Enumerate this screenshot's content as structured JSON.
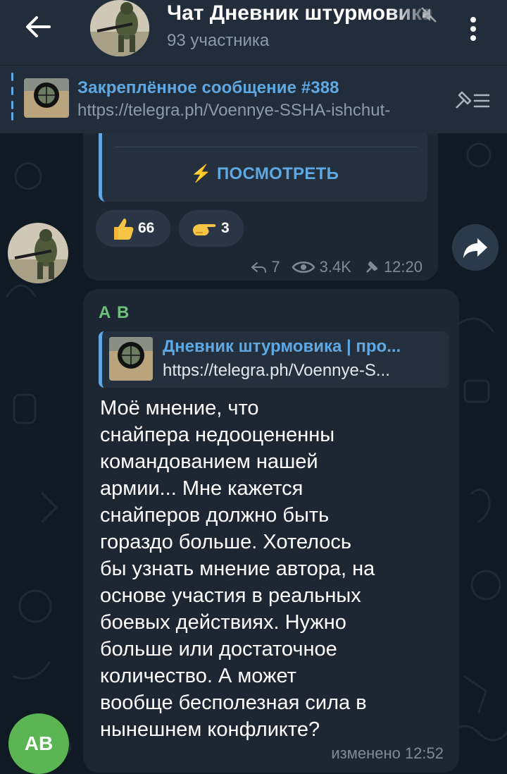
{
  "header": {
    "title": "Чат Дневник штурмовика",
    "subtitle": "93 участника"
  },
  "pinned": {
    "title": "Закреплённое сообщение #388",
    "url": "https://telegra.ph/Voennye-SSHA-ishchut-"
  },
  "message1": {
    "button_label": "ПОСМОТРЕТЬ",
    "reactions": [
      {
        "emoji": "thumbs-up",
        "count": "66"
      },
      {
        "emoji": "pointing-hand",
        "count": "3"
      }
    ],
    "replies": "7",
    "views": "3.4K",
    "time": "12:20"
  },
  "message2": {
    "sender": "А В",
    "reply_title": "Дневник штурмовика | про...",
    "reply_url": "https://telegra.ph/Voennye-S...",
    "text": "Моё мнение, что\nснайпера недооцененны\nкомандованием нашей\nармии... Мне кажется\nснайперов должно быть\nгораздо больше. Хотелось\nбы узнать мнение автора, на\nоснове участия в реальных\nбоевых действиях. Нужно\nбольше или достаточное\nколичество. А может\nвообще бесполезная сила в\nнынешнем конфликте?",
    "edited": "изменено 12:52",
    "avatar_initials": "AB"
  },
  "colors": {
    "accent": "#5fa8e2",
    "sender": "#6ec07a",
    "avatar_ab": "#5ab552"
  }
}
